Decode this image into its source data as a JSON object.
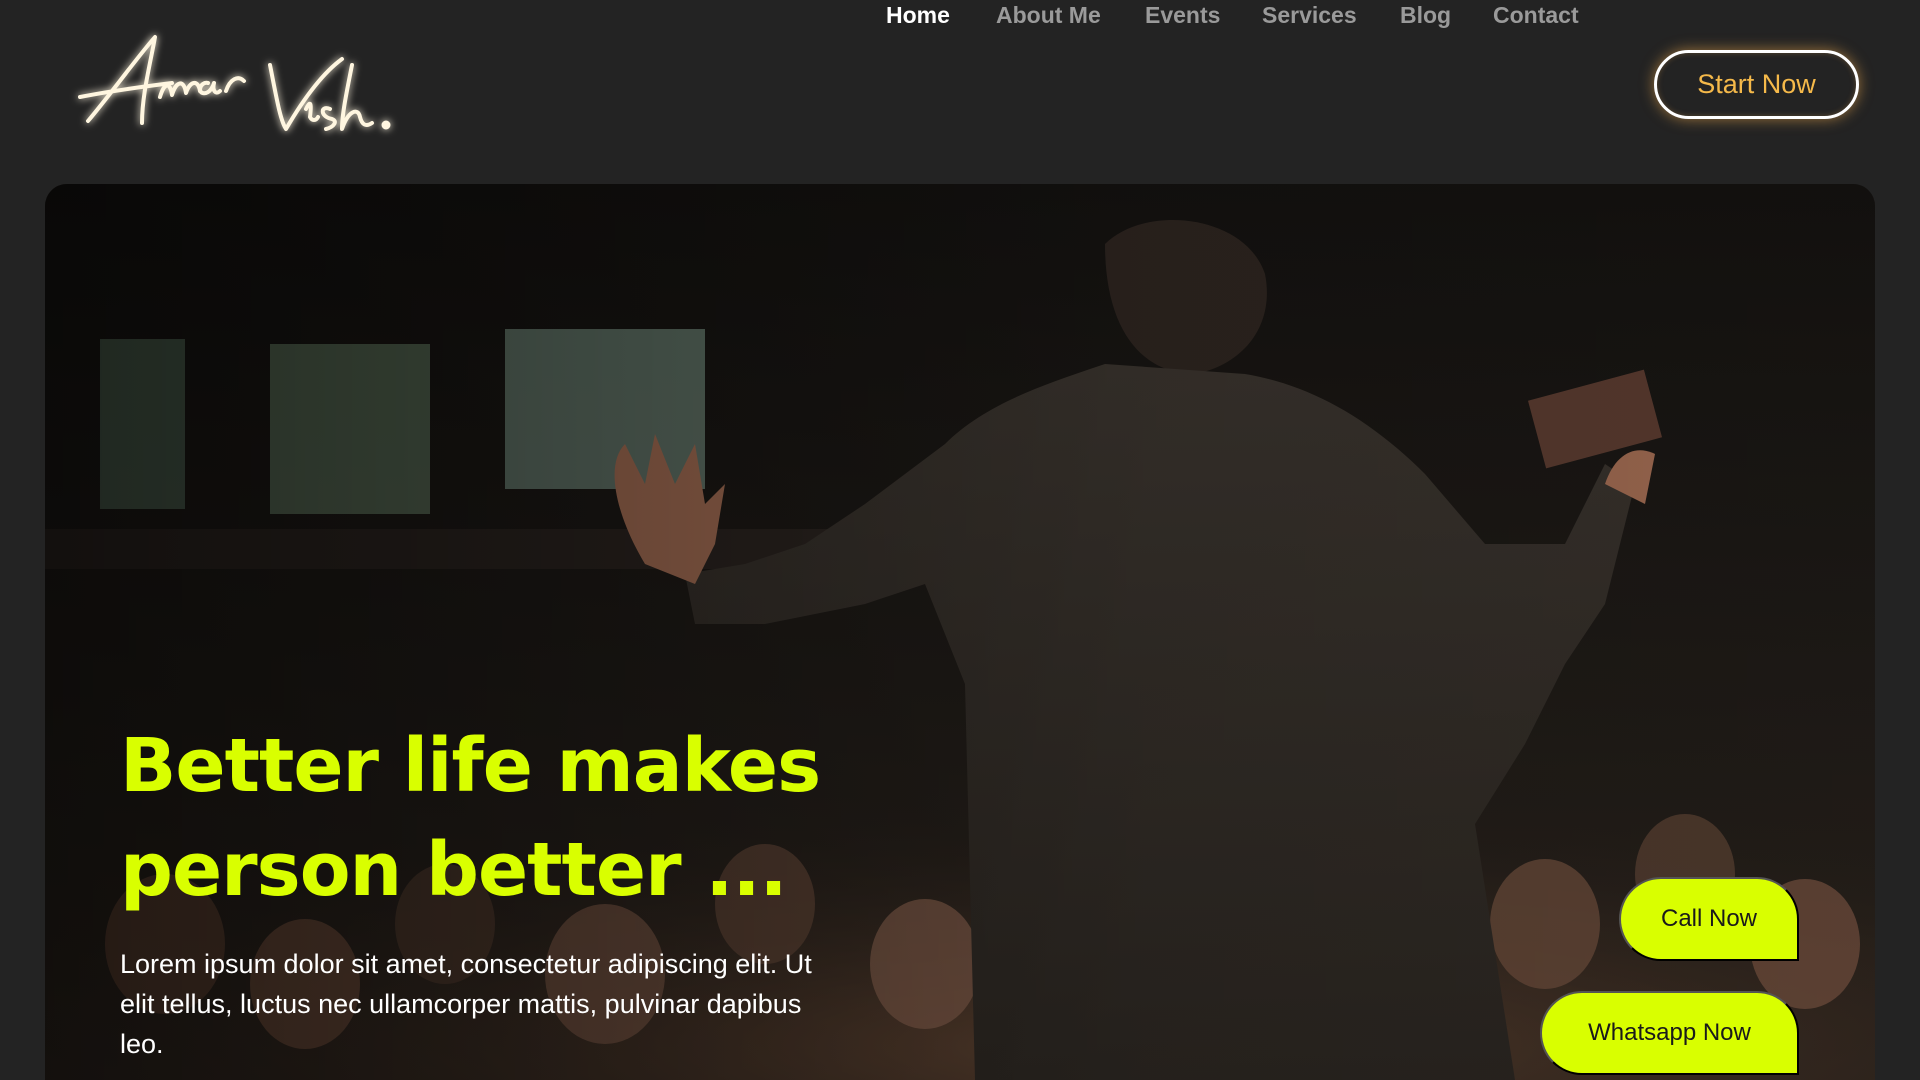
{
  "header": {
    "logo_text": "Amar Vish.",
    "nav": [
      {
        "label": "Home",
        "active": true
      },
      {
        "label": "About Me",
        "active": false
      },
      {
        "label": "Events",
        "active": false
      },
      {
        "label": "Services",
        "active": false
      },
      {
        "label": "Blog",
        "active": false
      },
      {
        "label": "Contact",
        "active": false
      }
    ],
    "cta_label": "Start Now"
  },
  "hero": {
    "title_line1": "Better life makes",
    "title_line2": "person better ...",
    "description": "Lorem ipsum dolor sit amet, consectetur adipiscing elit. Ut elit tellus, luctus nec ullamcorper mattis, pulvinar dapibus leo.",
    "call_label": "Call Now",
    "whatsapp_label": "Whatsapp Now"
  },
  "colors": {
    "background": "#232323",
    "accent": "#d9ff00",
    "cta_text": "#f5b94a",
    "nav_inactive": "#9a9a9a",
    "nav_active": "#ffffff"
  }
}
